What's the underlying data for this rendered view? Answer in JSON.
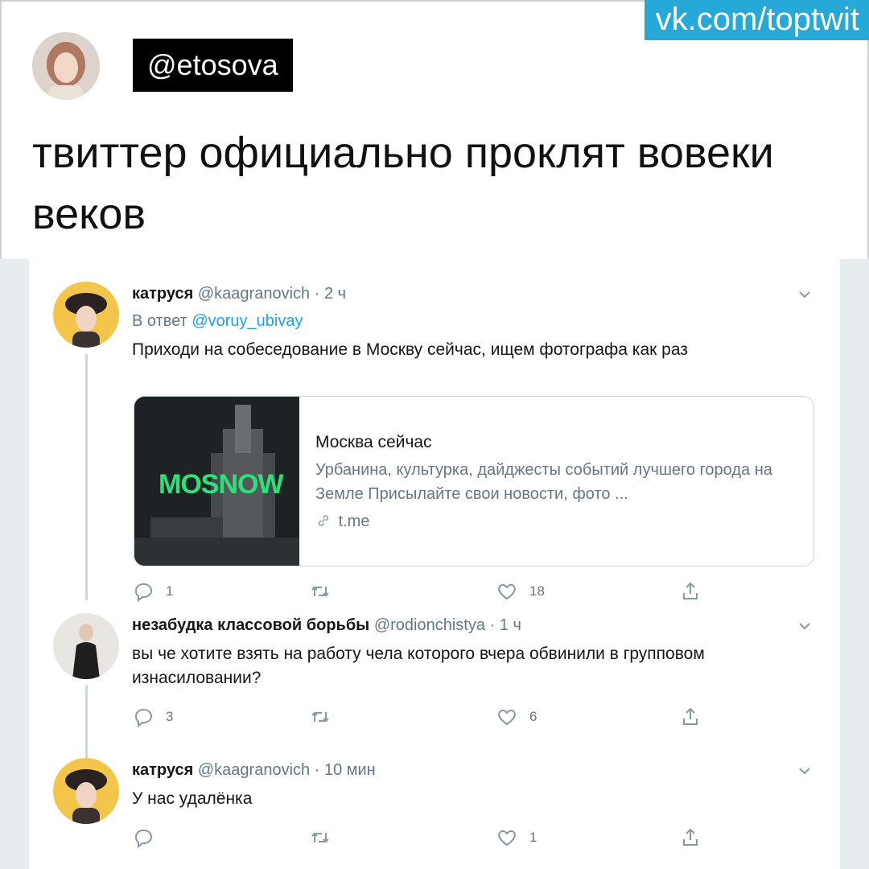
{
  "watermark": "vk.com/toptwit",
  "post": {
    "handle": "@etosova",
    "text": "твиттер официально проклят вовеки веков"
  },
  "colors": {
    "watermark_bg": "#26a8d9",
    "link": "#1da1f2",
    "muted": "#657786",
    "card_accent": "#2ee07a"
  },
  "tweets": [
    {
      "name": "катруся",
      "handle": "@kaagranovich",
      "time": "2 ч",
      "reply_label": "В ответ",
      "reply_to": "@voruy_ubivay",
      "text": "Приходи на собеседование в Москву сейчас, ищем фотографа как раз",
      "card": {
        "image_label": "MOSNOW",
        "title": "Москва сейчас",
        "description": "Урбанина, культурка, дайджесты событий лучшего города на Земле Присылайте свои новости, фото ...",
        "domain": "t.me"
      },
      "actions": {
        "replies": "1",
        "retweets": "",
        "likes": "18"
      }
    },
    {
      "name": "незабудка классовой борьбы",
      "handle": "@rodionchistya",
      "time": "1 ч",
      "text": "вы че хотите взять на работу чела которого вчера обвинили в групповом изнасиловании?",
      "actions": {
        "replies": "3",
        "retweets": "",
        "likes": "6"
      }
    },
    {
      "name": "катруся",
      "handle": "@kaagranovich",
      "time": "10 мин",
      "text": "У нас удалёнка",
      "actions": {
        "replies": "",
        "retweets": "",
        "likes": "1"
      }
    }
  ],
  "icons": [
    "chevron-down-icon",
    "reply-icon",
    "retweet-icon",
    "like-icon",
    "share-icon",
    "link-icon"
  ]
}
